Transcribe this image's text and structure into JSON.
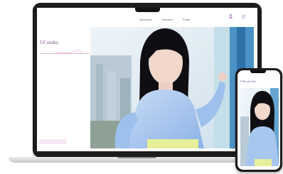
{
  "nav": {
    "items": [
      "Information",
      "Schedule",
      "Profile"
    ],
    "icons": [
      "user-icon",
      "menu-icon"
    ]
  },
  "site": {
    "subtitle": "",
    "title": "UConduc",
    "tagline": ""
  },
  "phone": {
    "subtitle": "",
    "title": "Official Site"
  },
  "colors": {
    "accent": "#7a5a86",
    "pink": "#f4e4f1",
    "hero_sky": "#dbeaf3",
    "blouse": "#a9c7ee",
    "skirt": "#e7ef9a"
  }
}
